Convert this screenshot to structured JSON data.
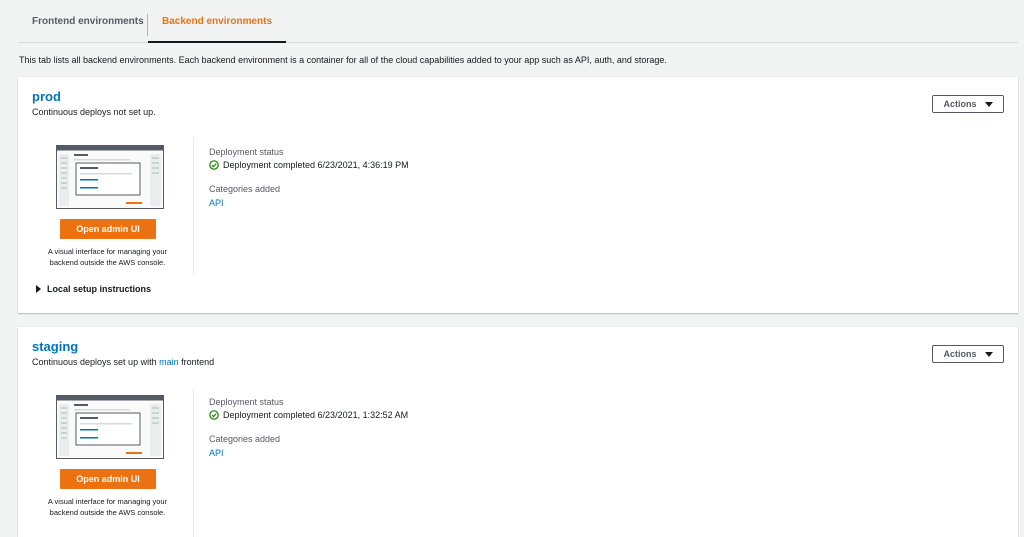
{
  "tabs": {
    "frontend": "Frontend environments",
    "backend": "Backend environments",
    "active_color": "#ec7211"
  },
  "intro": "This tab lists all backend environments. Each backend environment is a container for all of the cloud capabilities added to your app such as API, auth, and storage.",
  "environments": [
    {
      "name": "prod",
      "subtitle": "Continuous deploys not set up.",
      "actions_label": "Actions",
      "admin_button": "Open admin UI",
      "admin_desc_line1": "A visual interface for managing your",
      "admin_desc_line2": "backend outside the AWS console.",
      "status_label": "Deployment status",
      "status_text": "Deployment completed 6/23/2021, 4:36:19 PM",
      "categories_label": "Categories added",
      "category": "API",
      "local_setup": "Local setup instructions"
    },
    {
      "name": "staging",
      "subtitle_prefix": "Continuous deploys set up with",
      "subtitle_link": "main",
      "subtitle_suffix": "frontend",
      "actions_label": "Actions",
      "admin_button": "Open admin UI",
      "admin_desc_line1": "A visual interface for managing your",
      "admin_desc_line2": "backend outside the AWS console.",
      "status_label": "Deployment status",
      "status_text": "Deployment completed 6/23/2021, 1:32:52 AM",
      "categories_label": "Categories added",
      "category": "API"
    }
  ],
  "colors": {
    "link": "#0073bb",
    "primary_button": "#ec7211",
    "success": "#1d8102"
  }
}
